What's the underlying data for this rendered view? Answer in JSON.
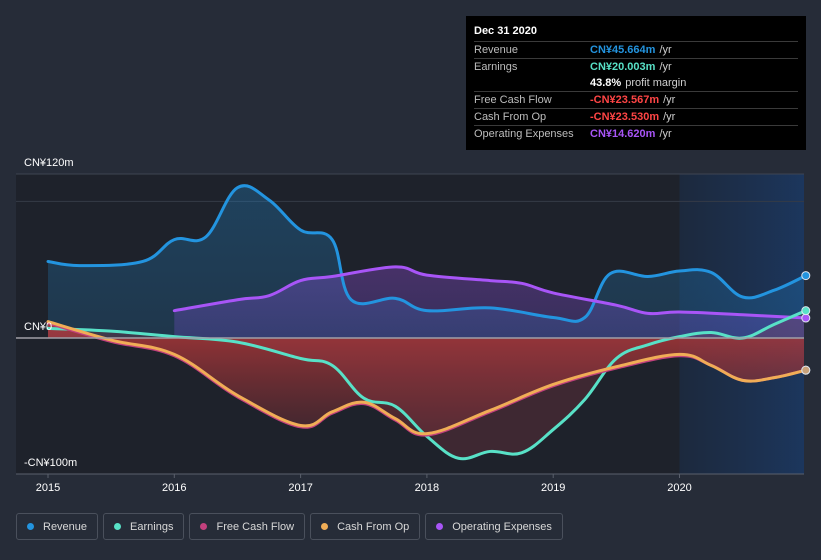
{
  "tooltip": {
    "date": "Dec 31 2020",
    "rows": [
      {
        "label": "Revenue",
        "value": "CN¥45.664m",
        "unit": "/yr",
        "color": "#2394df"
      },
      {
        "label": "Earnings",
        "value": "CN¥20.003m",
        "unit": "/yr",
        "color": "#58e1c7"
      },
      {
        "label": "",
        "value": "43.8%",
        "unit": "profit margin",
        "color": "#ffffff"
      },
      {
        "label": "Free Cash Flow",
        "value": "-CN¥23.567m",
        "unit": "/yr",
        "color": "#ff4545"
      },
      {
        "label": "Cash From Op",
        "value": "-CN¥23.530m",
        "unit": "/yr",
        "color": "#ff4545"
      },
      {
        "label": "Operating Expenses",
        "value": "CN¥14.620m",
        "unit": "/yr",
        "color": "#a855f7"
      }
    ]
  },
  "legend": [
    {
      "label": "Revenue",
      "color": "#2394df"
    },
    {
      "label": "Earnings",
      "color": "#58e1c7"
    },
    {
      "label": "Free Cash Flow",
      "color": "#c2407d"
    },
    {
      "label": "Cash From Op",
      "color": "#f0ad56"
    },
    {
      "label": "Operating Expenses",
      "color": "#a855f7"
    }
  ],
  "chart_data": {
    "type": "area",
    "title": "",
    "xlabel": "",
    "ylabel": "",
    "currency": "CN¥",
    "y_tick_labels": [
      "CN¥120m",
      "CN¥0",
      "-CN¥100m"
    ],
    "y_ticks": [
      120,
      0,
      -100
    ],
    "ylim": [
      -100,
      120
    ],
    "x_tick_labels": [
      "2015",
      "2016",
      "2017",
      "2018",
      "2019",
      "2020"
    ],
    "x_ticks": [
      2015,
      2016,
      2017,
      2018,
      2019,
      2020
    ],
    "xlim": [
      2014.75,
      2021.0
    ],
    "highlight_from": 2020.0,
    "grid": true,
    "legend_position": "bottom",
    "series": [
      {
        "name": "Revenue",
        "color": "#2394df",
        "x": [
          2015.0,
          2015.25,
          2015.75,
          2016.0,
          2016.25,
          2016.5,
          2016.75,
          2017.0,
          2017.25,
          2017.4,
          2017.75,
          2018.0,
          2018.5,
          2019.0,
          2019.25,
          2019.45,
          2019.75,
          2020.0,
          2020.25,
          2020.5,
          2020.75,
          2021.0
        ],
        "y": [
          56,
          53,
          56,
          72,
          74,
          110,
          101,
          79,
          72,
          28,
          29,
          20,
          22,
          15,
          15,
          47,
          45,
          49,
          48,
          30,
          35,
          45.664
        ]
      },
      {
        "name": "Operating Expenses",
        "color": "#a855f7",
        "x": [
          2016.0,
          2016.5,
          2016.75,
          2017.0,
          2017.25,
          2017.75,
          2018.0,
          2018.5,
          2018.75,
          2019.0,
          2019.5,
          2019.75,
          2020.0,
          2020.5,
          2021.0
        ],
        "y": [
          20,
          28,
          31,
          42,
          45,
          52,
          46,
          42,
          40,
          33,
          24,
          18,
          19,
          17,
          14.62
        ]
      },
      {
        "name": "Earnings",
        "color": "#58e1c7",
        "x": [
          2015.0,
          2015.5,
          2016.0,
          2016.5,
          2017.0,
          2017.25,
          2017.5,
          2017.75,
          2018.0,
          2018.25,
          2018.5,
          2018.75,
          2019.0,
          2019.25,
          2019.5,
          2019.75,
          2020.0,
          2020.25,
          2020.5,
          2020.75,
          2021.0
        ],
        "y": [
          7,
          5,
          1,
          -3,
          -15,
          -20,
          -44,
          -50,
          -72,
          -88,
          -83,
          -84,
          -67,
          -45,
          -15,
          -5,
          1,
          4,
          0,
          10,
          20.003
        ]
      },
      {
        "name": "Free Cash Flow",
        "color": "#c2407d",
        "x": [
          2015.0,
          2015.5,
          2016.0,
          2016.5,
          2017.0,
          2017.25,
          2017.5,
          2017.75,
          2018.0,
          2018.5,
          2019.0,
          2019.5,
          2020.0,
          2020.25,
          2020.5,
          2020.75,
          2021.0
        ],
        "y": [
          11,
          -2.5,
          -13,
          -43,
          -65,
          -55,
          -48,
          -60,
          -71,
          -54,
          -35,
          -22,
          -13,
          -20,
          -31,
          -29,
          -23.567
        ]
      },
      {
        "name": "Cash From Op",
        "color": "#f0ad56",
        "x": [
          2015.0,
          2015.5,
          2016.0,
          2016.5,
          2017.0,
          2017.25,
          2017.5,
          2017.75,
          2018.0,
          2018.5,
          2019.0,
          2019.5,
          2020.0,
          2020.25,
          2020.5,
          2020.75,
          2021.0
        ],
        "y": [
          12,
          -1.5,
          -12,
          -42,
          -64,
          -54,
          -47,
          -59,
          -70,
          -53,
          -34,
          -21,
          -12,
          -20,
          -31,
          -29,
          -23.53
        ]
      }
    ]
  }
}
